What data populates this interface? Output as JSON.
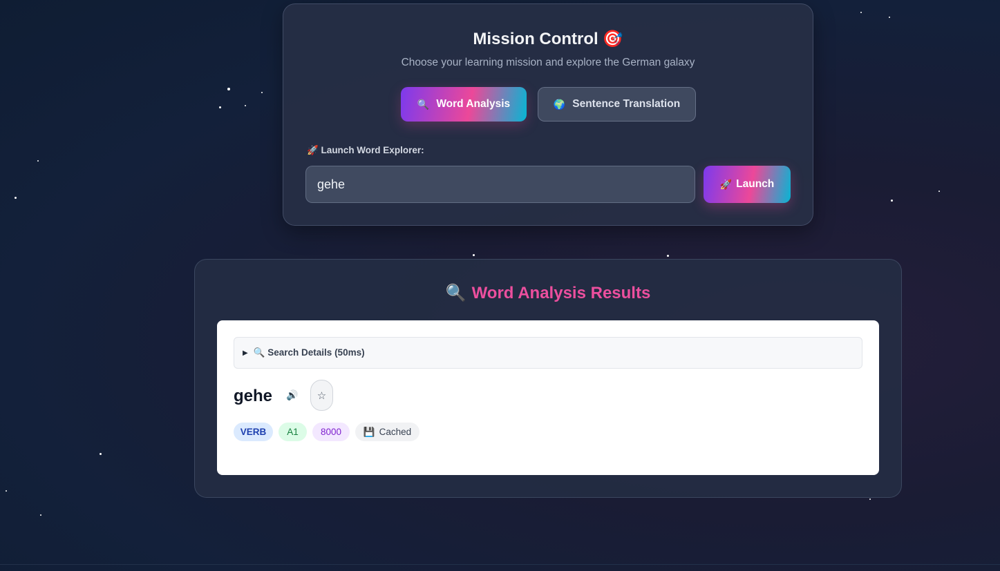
{
  "mission": {
    "title": "Mission Control",
    "title_emoji": "🎯",
    "subtitle": "Choose your learning mission and explore the German galaxy",
    "modes": [
      {
        "icon": "🔍",
        "label": "Word Analysis",
        "active": true
      },
      {
        "icon": "🌍",
        "label": "Sentence Translation",
        "active": false
      }
    ],
    "input_label": "🚀 Launch Word Explorer:",
    "input_value": "gehe",
    "launch_icon": "🚀",
    "launch_label": "Launch"
  },
  "results": {
    "title_icon": "🔍",
    "title": "Word Analysis Results",
    "details_label": "🔍 Search Details (50ms)",
    "word": "gehe",
    "speaker_icon": "🔊",
    "favorite_icon": "☆",
    "tags": {
      "part_of_speech": "VERB",
      "level": "A1",
      "frequency": "8000",
      "cache_icon": "💾",
      "cache_label": "Cached"
    }
  },
  "colors": {
    "accent_gradient": [
      "#7c3aed",
      "#ec4899",
      "#06b6d4"
    ],
    "results_title": "#ec4f9e"
  }
}
